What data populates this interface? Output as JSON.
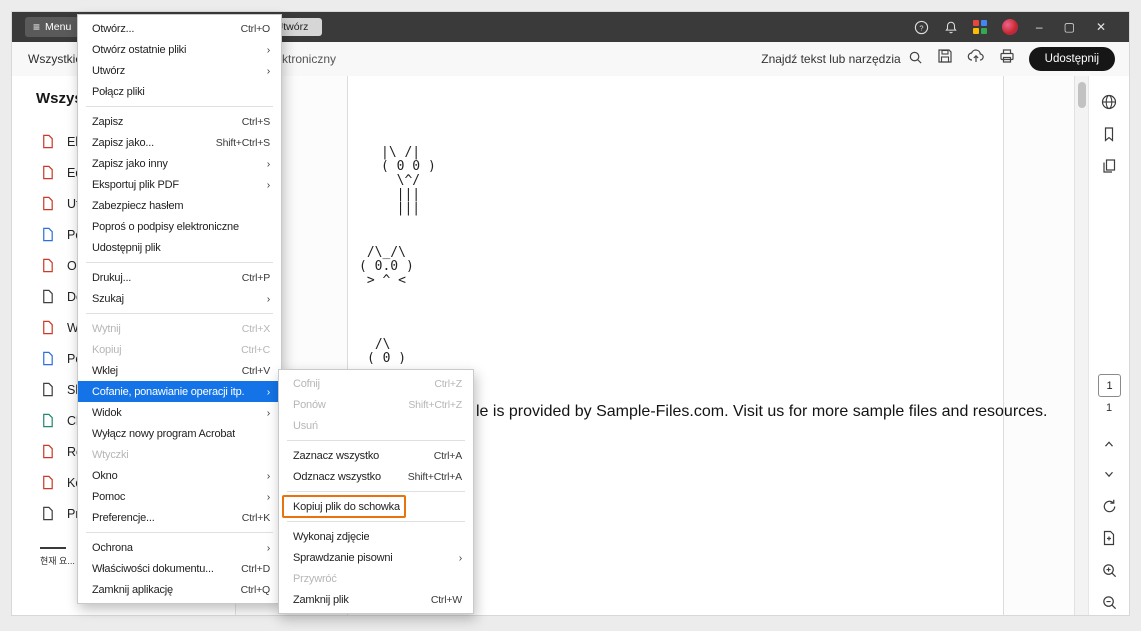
{
  "titlebar": {
    "menu_button_label": "Menu",
    "document_tab_label": "Utwórz",
    "minimize": "–",
    "maximize": "▢",
    "close": "✕"
  },
  "toolbar": {
    "tab_all": "Wszystkie",
    "tab_truncated": "ktroniczny",
    "search_label": "Znajdź tekst lub narzędzia",
    "share_button_label": "Udostępnij"
  },
  "sidebar": {
    "heading": "Wszyst",
    "items": [
      {
        "label": "Ek",
        "icon": "export-pdf-icon"
      },
      {
        "label": "Ed",
        "icon": "edit-pdf-icon"
      },
      {
        "label": "Ut",
        "icon": "create-pdf-icon"
      },
      {
        "label": "Po",
        "icon": "combine-files-icon"
      },
      {
        "label": "Or",
        "icon": "organize-pages-icon"
      },
      {
        "label": "Do",
        "icon": "add-comments-icon"
      },
      {
        "label": "Wy",
        "icon": "fill-sign-icon"
      },
      {
        "label": "Po",
        "icon": "request-signatures-icon"
      },
      {
        "label": "Sk",
        "icon": "scan-ocr-icon"
      },
      {
        "label": "Ch",
        "icon": "protect-pdf-icon"
      },
      {
        "label": "Re",
        "icon": "redact-icon"
      },
      {
        "label": "Ko",
        "icon": "compress-pdf-icon"
      },
      {
        "label": "Pr",
        "icon": "prepare-form-icon"
      }
    ],
    "footer": "현재 요..."
  },
  "file_menu": {
    "items": [
      {
        "label": "Otwórz...",
        "right": "Ctrl+O"
      },
      {
        "label": "Otwórz ostatnie pliki",
        "right": "›"
      },
      {
        "label": "Utwórz",
        "right": "›"
      },
      {
        "label": "Połącz pliki",
        "right": ""
      },
      {
        "label": "Zapisz",
        "right": "Ctrl+S"
      },
      {
        "label": "Zapisz jako...",
        "right": "Shift+Ctrl+S"
      },
      {
        "label": "Zapisz jako inny",
        "right": "›"
      },
      {
        "label": "Eksportuj plik PDF",
        "right": "›"
      },
      {
        "label": "Zabezpiecz hasłem",
        "right": ""
      },
      {
        "label": "Poproś o podpisy elektroniczne",
        "right": ""
      },
      {
        "label": "Udostępnij plik",
        "right": ""
      },
      {
        "label": "Drukuj...",
        "right": "Ctrl+P"
      },
      {
        "label": "Szukaj",
        "right": "›"
      },
      {
        "label": "Wytnij",
        "right": "Ctrl+X"
      },
      {
        "label": "Kopiuj",
        "right": "Ctrl+C"
      },
      {
        "label": "Wklej",
        "right": "Ctrl+V"
      },
      {
        "label": "Cofanie, ponawianie operacji itp.",
        "right": "›"
      },
      {
        "label": "Widok",
        "right": "›"
      },
      {
        "label": "Wyłącz nowy program Acrobat",
        "right": ""
      },
      {
        "label": "Wtyczki",
        "right": ""
      },
      {
        "label": "Okno",
        "right": "›"
      },
      {
        "label": "Pomoc",
        "right": "›"
      },
      {
        "label": "Preferencje...",
        "right": "Ctrl+K"
      },
      {
        "label": "Ochrona",
        "right": "›"
      },
      {
        "label": "Właściwości dokumentu...",
        "right": "Ctrl+D"
      },
      {
        "label": "Zamknij aplikację",
        "right": "Ctrl+Q"
      }
    ]
  },
  "submenu": {
    "items": [
      {
        "label": "Cofnij",
        "right": "Ctrl+Z"
      },
      {
        "label": "Ponów",
        "right": "Shift+Ctrl+Z"
      },
      {
        "label": "Usuń",
        "right": ""
      },
      {
        "label": "Zaznacz wszystko",
        "right": "Ctrl+A"
      },
      {
        "label": "Odznacz wszystko",
        "right": "Shift+Ctrl+A"
      },
      {
        "label": "Kopiuj plik do schowka",
        "right": ""
      },
      {
        "label": "Wykonaj zdjęcie",
        "right": ""
      },
      {
        "label": "Sprawdzanie pisowni",
        "right": "›"
      },
      {
        "label": "Przywróć",
        "right": ""
      },
      {
        "label": "Zamknij plik",
        "right": "Ctrl+W"
      }
    ]
  },
  "document": {
    "ascii_art_1": "|\\ /|\n( 0 0 )\n  \\^/\n  |||\n  |||",
    "ascii_art_2": " /\\_/\\\n( 0.0 )\n > ^ <",
    "ascii_art_3": " /\\\n( 0 )",
    "visible_text": "le is provided by Sample-Files.com. Visit us for more sample files and resources."
  },
  "right_panel": {
    "page_number": "1",
    "page_total": "1"
  }
}
